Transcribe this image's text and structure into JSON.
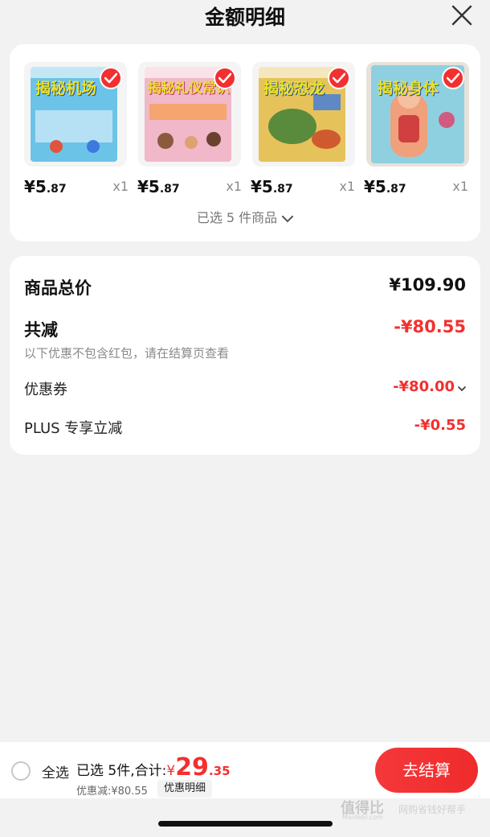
{
  "header": {
    "title": "金额明细"
  },
  "products": [
    {
      "title": "揭秘机场",
      "price_int": "¥5",
      "price_dec": ".87",
      "qty": "x1",
      "color": "#6cc3e8"
    },
    {
      "title": "揭秘礼仪常识",
      "price_int": "¥5",
      "price_dec": ".87",
      "qty": "x1",
      "color": "#f0b8c8"
    },
    {
      "title": "揭秘恐龙",
      "price_int": "¥5",
      "price_dec": ".87",
      "qty": "x1",
      "color": "#e6c25a"
    },
    {
      "title": "揭秘身体",
      "price_int": "¥5",
      "price_dec": ".87",
      "qty": "x1",
      "color": "#8fd0e0"
    }
  ],
  "selected_summary": "已选 5 件商品",
  "breakdown": {
    "total_label": "商品总价",
    "total_value": "¥109.90",
    "reduce_label": "共减",
    "reduce_value": "-¥80.55",
    "reduce_note": "以下优惠不包含红包，请在结算页查看",
    "coupon_label": "优惠券",
    "coupon_value": "-¥80.00",
    "plus_label": "PLUS 专享立减",
    "plus_value": "-¥0.55"
  },
  "bottom": {
    "select_all": "全选",
    "summary_prefix": "已选 5件,合计:",
    "currency": "¥",
    "amount_int": "29",
    "amount_dec": ".35",
    "discount_text": "优惠减:¥80.55",
    "detail_chip": "优惠明细",
    "checkout": "去结算"
  },
  "watermark": {
    "main": "值得比",
    "url": "Maidebi.com",
    "slogan": "网购省钱好帮手"
  },
  "colors": {
    "accent": "#f2302f",
    "background": "#f2f2f2"
  },
  "icons": [
    "close-icon",
    "check-icon",
    "chevron-down-icon",
    "radio-unchecked-icon"
  ]
}
